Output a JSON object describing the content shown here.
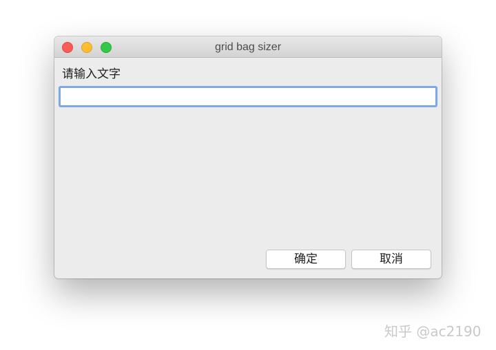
{
  "window": {
    "title": "grid bag sizer",
    "traffic_lights": {
      "close_color": "#fc5b57",
      "minimize_color": "#fdbd2e",
      "maximize_color": "#34c84a"
    }
  },
  "form": {
    "prompt_label": "请输入文字",
    "text_input": {
      "value": "",
      "placeholder": ""
    },
    "ok_button_label": "确定",
    "cancel_button_label": "取消"
  },
  "watermark": "知乎 @ac2190",
  "colors": {
    "focus_ring": "#7da7e6",
    "window_bg": "#ececec"
  }
}
